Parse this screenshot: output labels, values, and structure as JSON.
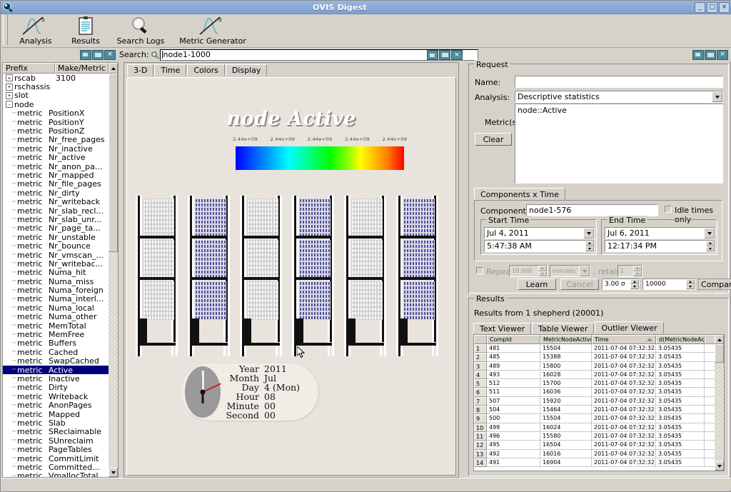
{
  "window": {
    "title": "OVIS Digest",
    "icon": "ovis-app-icon",
    "buttons": {
      "minimize": "_",
      "maximize": "□",
      "close": "×"
    }
  },
  "toolbar": {
    "items": [
      {
        "label": "Analysis",
        "icon": "analysis-curve-icon"
      },
      {
        "label": "Results",
        "icon": "clipboard-icon"
      },
      {
        "label": "Search Logs",
        "icon": "magnifier-icon"
      },
      {
        "label": "Metric Generator",
        "icon": "metric-curve-icon"
      }
    ]
  },
  "search": {
    "label": "Search:",
    "icon": "search-magnifier-icon",
    "value": "node1-1000",
    "placeholder": ""
  },
  "mdi_buttons": {
    "minimize": "minimize",
    "restore": "restore",
    "close": "×"
  },
  "tree": {
    "headers": [
      "Prefix",
      "Make/Metric"
    ],
    "rows": [
      {
        "type": "node",
        "expander": "+",
        "name": "rscab",
        "value": "3100"
      },
      {
        "type": "node",
        "expander": "+",
        "name": "rschassis",
        "value": ""
      },
      {
        "type": "node",
        "expander": "+",
        "name": "slot",
        "value": ""
      },
      {
        "type": "node",
        "expander": "-",
        "name": "node",
        "value": ""
      },
      {
        "type": "leaf",
        "name": "metric",
        "value": "PositionX"
      },
      {
        "type": "leaf",
        "name": "metric",
        "value": "PositionY"
      },
      {
        "type": "leaf",
        "name": "metric",
        "value": "PositionZ"
      },
      {
        "type": "leaf",
        "name": "metric",
        "value": "Nr_free_pages"
      },
      {
        "type": "leaf",
        "name": "metric",
        "value": "Nr_inactive"
      },
      {
        "type": "leaf",
        "name": "metric",
        "value": "Nr_active"
      },
      {
        "type": "leaf",
        "name": "metric",
        "value": "Nr_anon_pa..."
      },
      {
        "type": "leaf",
        "name": "metric",
        "value": "Nr_mapped"
      },
      {
        "type": "leaf",
        "name": "metric",
        "value": "Nr_file_pages"
      },
      {
        "type": "leaf",
        "name": "metric",
        "value": "Nr_dirty"
      },
      {
        "type": "leaf",
        "name": "metric",
        "value": "Nr_writeback"
      },
      {
        "type": "leaf",
        "name": "metric",
        "value": "Nr_slab_recl..."
      },
      {
        "type": "leaf",
        "name": "metric",
        "value": "Nr_slab_unr..."
      },
      {
        "type": "leaf",
        "name": "metric",
        "value": "Nr_page_ta..."
      },
      {
        "type": "leaf",
        "name": "metric",
        "value": "Nr_unstable"
      },
      {
        "type": "leaf",
        "name": "metric",
        "value": "Nr_bounce"
      },
      {
        "type": "leaf",
        "name": "metric",
        "value": "Nr_vmscan_..."
      },
      {
        "type": "leaf",
        "name": "metric",
        "value": "Nr_writebac..."
      },
      {
        "type": "leaf",
        "name": "metric",
        "value": "Numa_hit"
      },
      {
        "type": "leaf",
        "name": "metric",
        "value": "Numa_miss"
      },
      {
        "type": "leaf",
        "name": "metric",
        "value": "Numa_foreign"
      },
      {
        "type": "leaf",
        "name": "metric",
        "value": "Numa_interl..."
      },
      {
        "type": "leaf",
        "name": "metric",
        "value": "Numa_local"
      },
      {
        "type": "leaf",
        "name": "metric",
        "value": "Numa_other"
      },
      {
        "type": "leaf",
        "name": "metric",
        "value": "MemTotal"
      },
      {
        "type": "leaf",
        "name": "metric",
        "value": "MemFree"
      },
      {
        "type": "leaf",
        "name": "metric",
        "value": "Buffers"
      },
      {
        "type": "leaf",
        "name": "metric",
        "value": "Cached"
      },
      {
        "type": "leaf",
        "name": "metric",
        "value": "SwapCached"
      },
      {
        "type": "leaf",
        "name": "metric",
        "value": "Active",
        "selected": true
      },
      {
        "type": "leaf",
        "name": "metric",
        "value": "Inactive"
      },
      {
        "type": "leaf",
        "name": "metric",
        "value": "Dirty"
      },
      {
        "type": "leaf",
        "name": "metric",
        "value": "Writeback"
      },
      {
        "type": "leaf",
        "name": "metric",
        "value": "AnonPages"
      },
      {
        "type": "leaf",
        "name": "metric",
        "value": "Mapped"
      },
      {
        "type": "leaf",
        "name": "metric",
        "value": "Slab"
      },
      {
        "type": "leaf",
        "name": "metric",
        "value": "SReclaimable"
      },
      {
        "type": "leaf",
        "name": "metric",
        "value": "SUnreclaim"
      },
      {
        "type": "leaf",
        "name": "metric",
        "value": "PageTables"
      },
      {
        "type": "leaf",
        "name": "metric",
        "value": "CommitLimit"
      },
      {
        "type": "leaf",
        "name": "metric",
        "value": "Committed..."
      },
      {
        "type": "leaf",
        "name": "metric",
        "value": "VmallocTotal"
      }
    ]
  },
  "visualization": {
    "tabs": [
      {
        "label": "3-D",
        "active": true
      },
      {
        "label": "Time",
        "active": false
      },
      {
        "label": "Colors",
        "active": false
      },
      {
        "label": "Display",
        "active": false
      }
    ],
    "title": "node Active",
    "colorbar": {
      "labels": [
        "2.44e+09",
        "2.44e+09",
        "2.44e+09",
        "2.44e+09",
        "2.44e+09"
      ],
      "low_color": "#0000ff",
      "high_color": "#ff0000"
    },
    "racks": {
      "count": 6,
      "fill_colors": [
        "#ffffff",
        "#4f4f96"
      ],
      "pattern": [
        "white",
        "blue",
        "white",
        "blue",
        "white",
        "blue"
      ]
    },
    "clock": {
      "fields": [
        {
          "key": "Year",
          "value": "2011"
        },
        {
          "key": "Month",
          "value": "Jul"
        },
        {
          "key": "Day",
          "value": "4 (Mon)"
        },
        {
          "key": "Hour",
          "value": "08"
        },
        {
          "key": "Minute",
          "value": "00"
        },
        {
          "key": "Second",
          "value": "00"
        }
      ]
    }
  },
  "request": {
    "legend": "Request",
    "name_label": "Name:",
    "name_value": "",
    "analysis_label": "Analysis:",
    "analysis_value": "Descriptive statistics",
    "metrics_label": "Metric(s):",
    "metrics_value": "node::Active",
    "clear_label": "Clear",
    "tab_label": "Components x Time",
    "components_label": "Component(s):",
    "components_value": "node1-576",
    "idle_label": "Idle times only",
    "idle_checked": false,
    "start_time": {
      "legend": "Start Time",
      "date": "Jul 4, 2011",
      "time": "5:47:38 AM"
    },
    "end_time": {
      "legend": "End Time",
      "date": "Jul 6, 2011",
      "time": "12:17:34 PM"
    },
    "repeat_label": "Repeat:",
    "repeat_value": "10.000",
    "repeat_units": "minutes",
    "retain_label": ", retain",
    "retain_value": "1",
    "learn_label": "Learn",
    "cancel_label": "Cancel",
    "sigma_value": "3.00 σ",
    "count_value": "10000",
    "compare_label": "Compare"
  },
  "results": {
    "legend": "Results",
    "summary": "Results from 1 shepherd (20001)",
    "tabs": [
      {
        "label": "Text Viewer",
        "active": false
      },
      {
        "label": "Table Viewer",
        "active": false
      },
      {
        "label": "Outlier Viewer",
        "active": true
      }
    ],
    "columns": [
      "",
      "CompId",
      "MetricNodeActiveValu",
      "Time",
      "d(MetricNodeActiveVa",
      ""
    ],
    "sort_column": "Time",
    "rows": [
      {
        "n": "1",
        "compid": "481",
        "value": "15504",
        "time": "2011-07-04 07:32:32",
        "delta": "3.05435"
      },
      {
        "n": "2",
        "compid": "485",
        "value": "15388",
        "time": "2011-07-04 07:32:32",
        "delta": "3.05435"
      },
      {
        "n": "3",
        "compid": "489",
        "value": "15800",
        "time": "2011-07-04 07:32:32",
        "delta": "3.05435"
      },
      {
        "n": "4",
        "compid": "493",
        "value": "16028",
        "time": "2011-07-04 07:32:32",
        "delta": "3.05435"
      },
      {
        "n": "5",
        "compid": "512",
        "value": "15700",
        "time": "2011-07-04 07:32:32",
        "delta": "3.05435"
      },
      {
        "n": "6",
        "compid": "511",
        "value": "16036",
        "time": "2011-07-04 07:32:32",
        "delta": "3.05435"
      },
      {
        "n": "7",
        "compid": "507",
        "value": "15920",
        "time": "2011-07-04 07:32:32",
        "delta": "3.05435"
      },
      {
        "n": "8",
        "compid": "504",
        "value": "15464",
        "time": "2011-07-04 07:32:32",
        "delta": "3.05435"
      },
      {
        "n": "9",
        "compid": "500",
        "value": "15504",
        "time": "2011-07-04 07:32:32",
        "delta": "3.05435"
      },
      {
        "n": "10",
        "compid": "499",
        "value": "16024",
        "time": "2011-07-04 07:32:32",
        "delta": "3.05435"
      },
      {
        "n": "11",
        "compid": "496",
        "value": "15580",
        "time": "2011-07-04 07:32:32",
        "delta": "3.05435"
      },
      {
        "n": "12",
        "compid": "495",
        "value": "16504",
        "time": "2011-07-04 07:32:32",
        "delta": "3.05435"
      },
      {
        "n": "13",
        "compid": "492",
        "value": "16016",
        "time": "2011-07-04 07:32:32",
        "delta": "3.05435"
      },
      {
        "n": "14",
        "compid": "491",
        "value": "16904",
        "time": "2011-07-04 07:32:32",
        "delta": "3.05435"
      }
    ]
  }
}
